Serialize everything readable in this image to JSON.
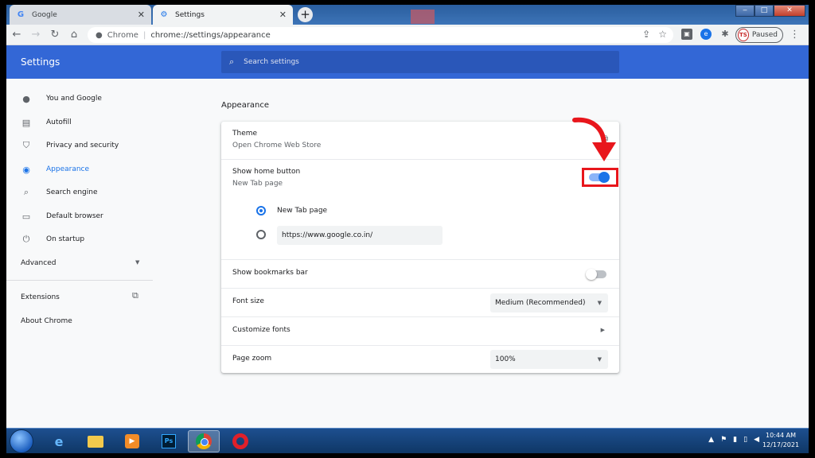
{
  "tabs": [
    {
      "title": "Google",
      "favicon": "google-g-icon"
    },
    {
      "title": "Settings",
      "favicon": "gear-icon"
    }
  ],
  "window_controls": {
    "minimize": "‒",
    "maximize": "□",
    "close": "✕"
  },
  "omnibox": {
    "site": "Chrome",
    "url": "chrome://settings/appearance"
  },
  "profile": {
    "initials": "TS",
    "status": "Paused"
  },
  "header": {
    "title": "Settings",
    "search_placeholder": "Search settings"
  },
  "sidebar": {
    "items": [
      {
        "label": "You and Google",
        "icon": "person-icon"
      },
      {
        "label": "Autofill",
        "icon": "clipboard-icon"
      },
      {
        "label": "Privacy and security",
        "icon": "shield-icon"
      },
      {
        "label": "Appearance",
        "icon": "palette-icon",
        "active": true
      },
      {
        "label": "Search engine",
        "icon": "search-icon"
      },
      {
        "label": "Default browser",
        "icon": "browser-window-icon"
      },
      {
        "label": "On startup",
        "icon": "power-icon"
      }
    ],
    "advanced": "Advanced",
    "extensions": "Extensions",
    "about": "About Chrome"
  },
  "appearance": {
    "section_title": "Appearance",
    "theme": {
      "label": "Theme",
      "sub": "Open Chrome Web Store"
    },
    "home_button": {
      "label": "Show home button",
      "sub": "New Tab page",
      "enabled": true,
      "option_new_tab": "New Tab page",
      "custom_url": "https://www.google.co.in/",
      "selected": "new_tab"
    },
    "bookmarks_bar": {
      "label": "Show bookmarks bar",
      "enabled": false
    },
    "font_size": {
      "label": "Font size",
      "value": "Medium (Recommended)"
    },
    "customize_fonts": {
      "label": "Customize fonts"
    },
    "page_zoom": {
      "label": "Page zoom",
      "value": "100%"
    }
  },
  "taskbar": {
    "apps": [
      "internet-explorer",
      "file-explorer",
      "media-player",
      "photoshop",
      "chrome",
      "opera"
    ],
    "ps_label": "Ps",
    "time": "10:44 AM",
    "date": "12/17/2021"
  },
  "colors": {
    "accent": "#1a73e8",
    "header": "#3367d6",
    "highlight": "#e8161c"
  }
}
